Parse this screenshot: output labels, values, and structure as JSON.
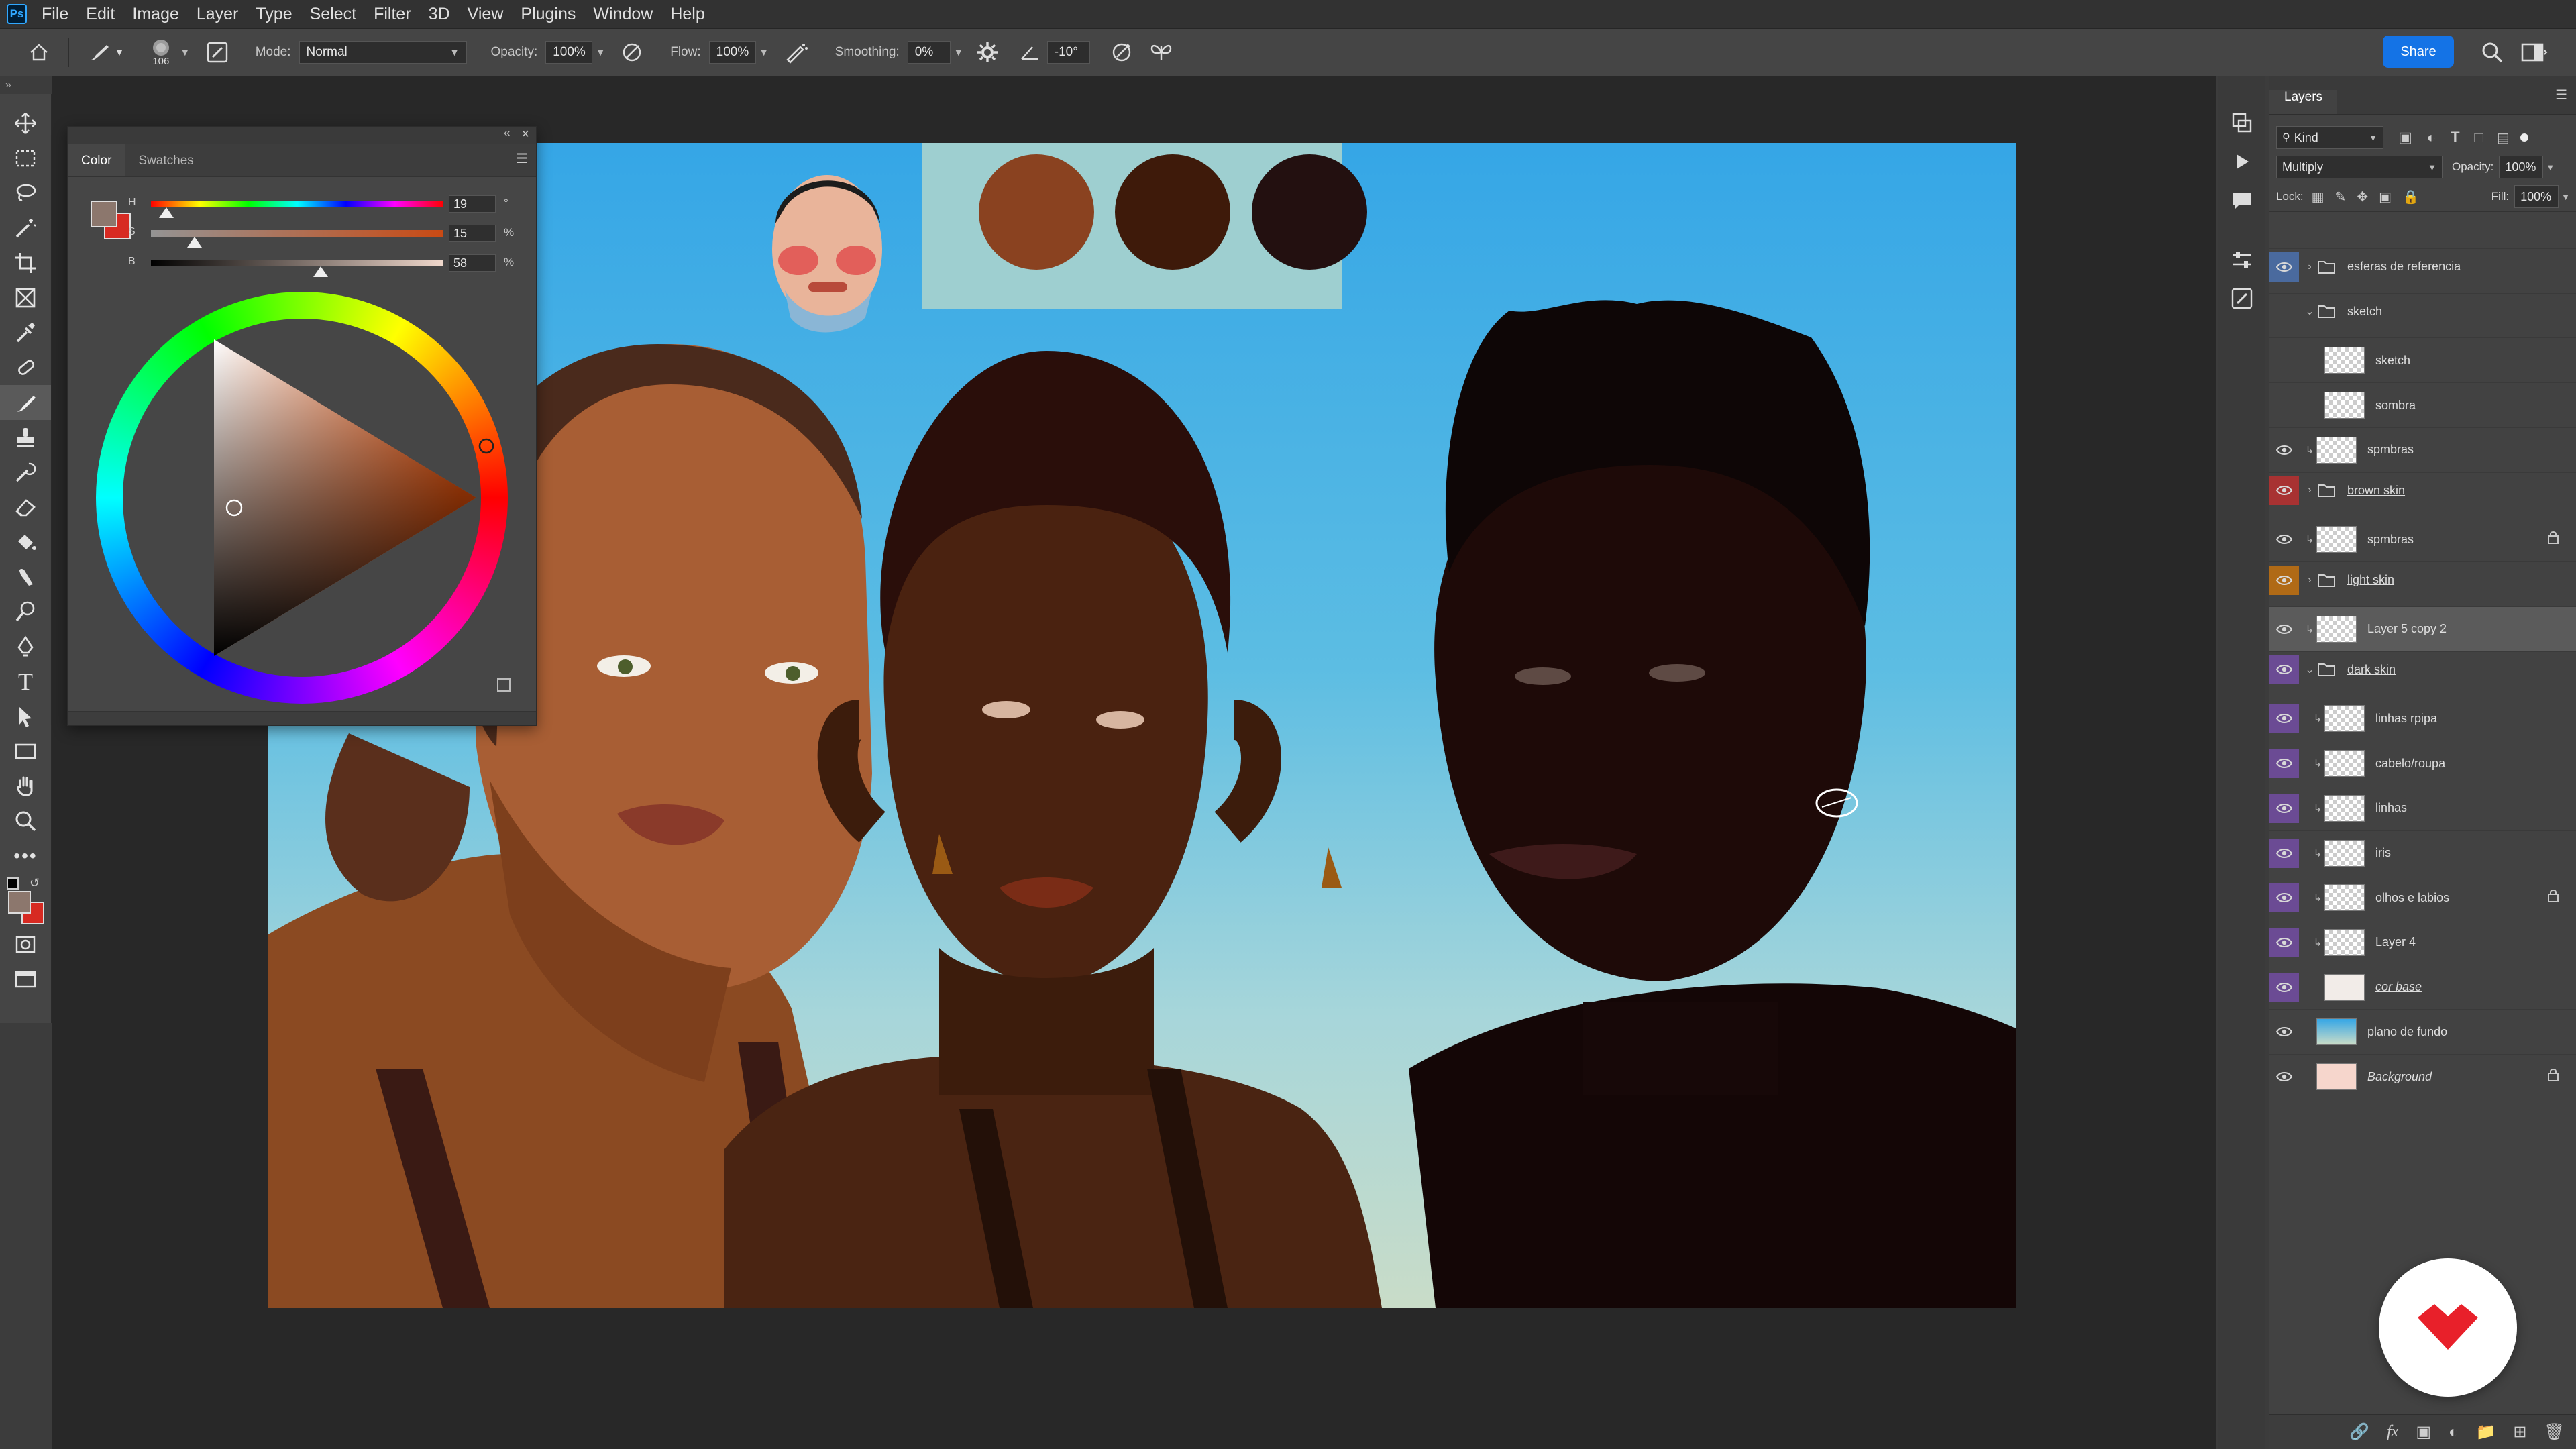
{
  "app": {
    "logo": "Ps"
  },
  "menu": [
    "File",
    "Edit",
    "Image",
    "Layer",
    "Type",
    "Select",
    "Filter",
    "3D",
    "View",
    "Plugins",
    "Window",
    "Help"
  ],
  "options": {
    "brush_size": "106",
    "mode_label": "Mode:",
    "mode_value": "Normal",
    "opacity_label": "Opacity:",
    "opacity_value": "100%",
    "flow_label": "Flow:",
    "flow_value": "100%",
    "smoothing_label": "Smoothing:",
    "smoothing_value": "0%",
    "angle_value": "-10°",
    "share_label": "Share"
  },
  "color_panel": {
    "tabs": [
      "Color",
      "Swatches"
    ],
    "sliders": [
      {
        "letter": "H",
        "value": "19",
        "unit": "°",
        "fraction": 0.053
      },
      {
        "letter": "S",
        "value": "15",
        "unit": "%",
        "fraction": 0.15
      },
      {
        "letter": "B",
        "value": "58",
        "unit": "%",
        "fraction": 0.58
      }
    ],
    "foreground": "#8c776d",
    "background": "#d72a22"
  },
  "layers_panel": {
    "tab": "Layers",
    "filter": "Kind",
    "blend_mode": "Multiply",
    "opacity_label": "Opacity:",
    "opacity_value": "100%",
    "lock_label": "Lock:",
    "fill_label": "Fill:",
    "fill_value": "100%",
    "layers": [
      {
        "name": "esferas de referencia",
        "kind": "group",
        "visible": true,
        "tag": "blue",
        "expanded": false
      },
      {
        "name": "sketch",
        "kind": "group",
        "visible": false,
        "tag": "",
        "expanded": true
      },
      {
        "name": "sketch",
        "kind": "layer",
        "visible": false,
        "tag": "",
        "indent": 1
      },
      {
        "name": "sombra",
        "kind": "layer",
        "visible": false,
        "tag": "",
        "indent": 1
      },
      {
        "name": "spmbras",
        "kind": "layer",
        "visible": true,
        "tag": "",
        "clip": true
      },
      {
        "name": "brown skin",
        "kind": "group",
        "visible": true,
        "tag": "red",
        "expanded": false,
        "underline": true
      },
      {
        "name": "spmbras",
        "kind": "layer",
        "visible": true,
        "tag": "",
        "clip": true,
        "locked": true
      },
      {
        "name": "light skin",
        "kind": "group",
        "visible": true,
        "tag": "orange",
        "expanded": false,
        "underline": true
      },
      {
        "name": "Layer 5 copy 2",
        "kind": "layer",
        "visible": true,
        "tag": "",
        "clip": true,
        "selected": true
      },
      {
        "name": "dark skin",
        "kind": "group",
        "visible": true,
        "tag": "violet",
        "expanded": true,
        "underline": true
      },
      {
        "name": "linhas rpipa",
        "kind": "layer",
        "visible": true,
        "tag": "violet",
        "clip": true,
        "indent": 1
      },
      {
        "name": "cabelo/roupa",
        "kind": "layer",
        "visible": true,
        "tag": "violet",
        "clip": true,
        "indent": 1
      },
      {
        "name": "linhas",
        "kind": "layer",
        "visible": true,
        "tag": "violet",
        "clip": true,
        "indent": 1
      },
      {
        "name": "iris",
        "kind": "layer",
        "visible": true,
        "tag": "violet",
        "clip": true,
        "indent": 1
      },
      {
        "name": "olhos e labios",
        "kind": "layer",
        "visible": true,
        "tag": "violet",
        "clip": true,
        "indent": 1,
        "locked": true
      },
      {
        "name": "Layer 4",
        "kind": "layer",
        "visible": true,
        "tag": "violet",
        "clip": true,
        "indent": 1
      },
      {
        "name": "cor base",
        "kind": "layer",
        "visible": true,
        "tag": "violet",
        "indent": 1,
        "underline": true,
        "italic": true
      },
      {
        "name": "plano de fundo",
        "kind": "layer",
        "visible": true,
        "tag": ""
      },
      {
        "name": "Background",
        "kind": "layer",
        "visible": true,
        "tag": "",
        "italic": true,
        "locked": true
      }
    ]
  },
  "colors": {
    "accent": "#1473e6",
    "ps_blue": "#31a8ff",
    "watermark": "#e8202a",
    "swatch_1": "#8a4220",
    "swatch_2": "#3e1a0a",
    "swatch_3": "#231010"
  }
}
